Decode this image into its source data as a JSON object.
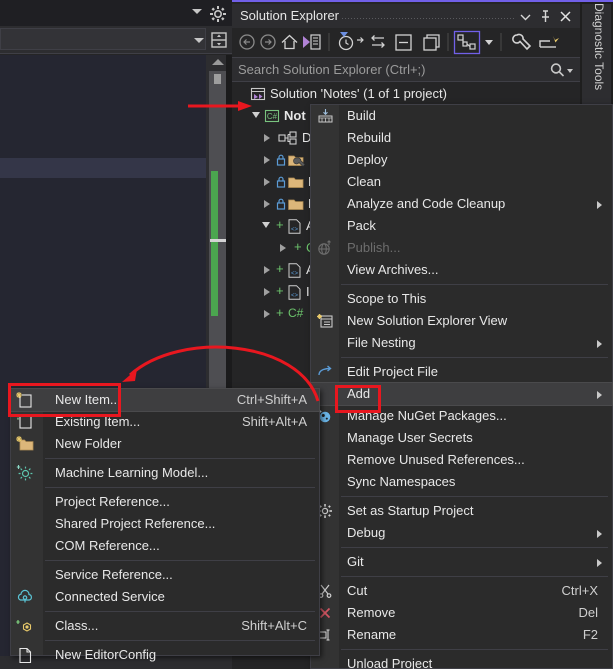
{
  "window": {
    "diagnostic_tools_tab": "Diagnostic Tools"
  },
  "solution_explorer": {
    "title": "Solution Explorer",
    "title_icons": [
      "chevron-down-icon",
      "pin-icon",
      "close-icon"
    ],
    "toolbar_icons": [
      "back-arrow-icon",
      "forward-arrow-icon",
      "home-icon",
      "sync-with-active-document-icon",
      "pending-changes-filter-icon",
      "chevron-down-icon",
      "show-all-files-icon",
      "collapse-all-icon",
      "new-solution-explorer-view-icon",
      "properties-icon",
      "chevron-down-icon",
      "properties-wrench-icon",
      "preview-selected-items-icon"
    ],
    "search_placeholder": "Search Solution Explorer (Ctrl+;)",
    "search_icon": "magnifier-icon",
    "tree": [
      {
        "label": "Solution 'Notes' (1 of 1 project)",
        "icon": "solution-icon",
        "indent": 8,
        "expander": "none"
      },
      {
        "label": "Not",
        "icon": "csharp-project-icon",
        "indent": 26,
        "expander": "open",
        "bold": true
      },
      {
        "label": "D",
        "icon": "dependencies-icon",
        "indent": 44,
        "expander": "closed"
      },
      {
        "label": "P",
        "icon": "folder-locked-wrench-icon",
        "indent": 44,
        "expander": "closed"
      },
      {
        "label": "P",
        "icon": "folder-locked-icon",
        "indent": 44,
        "expander": "closed"
      },
      {
        "label": "P",
        "icon": "folder-locked-icon",
        "indent": 44,
        "expander": "closed"
      },
      {
        "label": "A",
        "icon": "razor-file-icon",
        "indent": 44,
        "expander": "open"
      },
      {
        "label": "C",
        "icon": "csharp-file-icon",
        "indent": 62,
        "expander": "closed"
      },
      {
        "label": "A",
        "icon": "razor-file-icon",
        "indent": 44,
        "expander": "closed"
      },
      {
        "label": "I",
        "icon": "razor-file-icon",
        "indent": 44,
        "expander": "closed"
      },
      {
        "label": "",
        "icon": "csharp-file-icon",
        "indent": 44,
        "expander": "closed"
      }
    ]
  },
  "context_menu": {
    "items": [
      {
        "label": "Build",
        "icon": "build-icon",
        "shortcut": "",
        "submenu": false,
        "disabled": false,
        "sep_after": false
      },
      {
        "label": "Rebuild",
        "icon": "",
        "shortcut": "",
        "submenu": false,
        "disabled": false,
        "sep_after": false
      },
      {
        "label": "Deploy",
        "icon": "",
        "shortcut": "",
        "submenu": false,
        "disabled": false,
        "sep_after": false
      },
      {
        "label": "Clean",
        "icon": "",
        "shortcut": "",
        "submenu": false,
        "disabled": false,
        "sep_after": false
      },
      {
        "label": "Analyze and Code Cleanup",
        "icon": "",
        "shortcut": "",
        "submenu": true,
        "disabled": false,
        "sep_after": false
      },
      {
        "label": "Pack",
        "icon": "",
        "shortcut": "",
        "submenu": false,
        "disabled": false,
        "sep_after": false
      },
      {
        "label": "Publish...",
        "icon": "publish-globe-icon",
        "shortcut": "",
        "submenu": false,
        "disabled": true,
        "sep_after": false
      },
      {
        "label": "View Archives...",
        "icon": "",
        "shortcut": "",
        "submenu": false,
        "disabled": false,
        "sep_after": true
      },
      {
        "label": "Scope to This",
        "icon": "",
        "shortcut": "",
        "submenu": false,
        "disabled": false,
        "sep_after": false
      },
      {
        "label": "New Solution Explorer View",
        "icon": "new-solution-view-icon",
        "shortcut": "",
        "submenu": false,
        "disabled": false,
        "sep_after": false
      },
      {
        "label": "File Nesting",
        "icon": "",
        "shortcut": "",
        "submenu": true,
        "disabled": false,
        "sep_after": true
      },
      {
        "label": "Edit Project File",
        "icon": "edit-project-file-icon",
        "shortcut": "",
        "submenu": false,
        "disabled": false,
        "sep_after": false
      },
      {
        "label": "Add",
        "icon": "",
        "shortcut": "",
        "submenu": true,
        "disabled": false,
        "sep_after": false,
        "highlighted": true
      },
      {
        "label": "Manage NuGet Packages...",
        "icon": "nuget-icon",
        "shortcut": "",
        "submenu": false,
        "disabled": false,
        "sep_after": false
      },
      {
        "label": "Manage User Secrets",
        "icon": "",
        "shortcut": "",
        "submenu": false,
        "disabled": false,
        "sep_after": false
      },
      {
        "label": "Remove Unused References...",
        "icon": "",
        "shortcut": "",
        "submenu": false,
        "disabled": false,
        "sep_after": false
      },
      {
        "label": "Sync Namespaces",
        "icon": "",
        "shortcut": "",
        "submenu": false,
        "disabled": false,
        "sep_after": true
      },
      {
        "label": "Set as Startup Project",
        "icon": "gear-icon",
        "shortcut": "",
        "submenu": false,
        "disabled": false,
        "sep_after": false
      },
      {
        "label": "Debug",
        "icon": "",
        "shortcut": "",
        "submenu": true,
        "disabled": false,
        "sep_after": true
      },
      {
        "label": "Git",
        "icon": "",
        "shortcut": "",
        "submenu": true,
        "disabled": false,
        "sep_after": true
      },
      {
        "label": "Cut",
        "icon": "scissors-icon",
        "shortcut": "Ctrl+X",
        "submenu": false,
        "disabled": false,
        "sep_after": false
      },
      {
        "label": "Remove",
        "icon": "x-remove-icon",
        "shortcut": "Del",
        "submenu": false,
        "disabled": false,
        "sep_after": false
      },
      {
        "label": "Rename",
        "icon": "rename-icon",
        "shortcut": "F2",
        "submenu": false,
        "disabled": false,
        "sep_after": true
      },
      {
        "label": "Unload Project",
        "icon": "",
        "shortcut": "",
        "submenu": false,
        "disabled": false,
        "sep_after": false
      }
    ]
  },
  "add_submenu": {
    "items": [
      {
        "label": "New Item...",
        "icon": "new-item-icon",
        "shortcut": "Ctrl+Shift+A",
        "sep_after": false,
        "highlighted": true
      },
      {
        "label": "Existing Item...",
        "icon": "existing-item-icon",
        "shortcut": "Shift+Alt+A",
        "sep_after": false
      },
      {
        "label": "New Folder",
        "icon": "new-folder-icon",
        "shortcut": "",
        "sep_after": true
      },
      {
        "label": "Machine Learning Model...",
        "icon": "ml-model-icon",
        "shortcut": "",
        "sep_after": true
      },
      {
        "label": "Project Reference...",
        "icon": "",
        "shortcut": "",
        "sep_after": false
      },
      {
        "label": "Shared Project Reference...",
        "icon": "",
        "shortcut": "",
        "sep_after": false
      },
      {
        "label": "COM Reference...",
        "icon": "",
        "shortcut": "",
        "sep_after": true
      },
      {
        "label": "Service Reference...",
        "icon": "",
        "shortcut": "",
        "sep_after": false
      },
      {
        "label": "Connected Service",
        "icon": "connected-service-icon",
        "shortcut": "",
        "sep_after": true
      },
      {
        "label": "Class...",
        "icon": "class-icon",
        "shortcut": "Shift+Alt+C",
        "sep_after": true
      },
      {
        "label": "New EditorConfig",
        "icon": "editorconfig-file-icon",
        "shortcut": "",
        "sep_after": false
      }
    ]
  },
  "annotations": {
    "color": "#e8171f",
    "boxes": [
      "add-menu-item",
      "new-item-menu-item"
    ],
    "arrows": [
      "arrow-to-project-node",
      "curved-arrow-add-to-new-item"
    ]
  },
  "colors": {
    "accent": "#7160e8",
    "annotation_red": "#e8171f",
    "menu_bg": "#2b2b2b",
    "panel_bg": "#252526",
    "highlight": "#3e3e40",
    "change_bar_green": "#4ba54f"
  }
}
